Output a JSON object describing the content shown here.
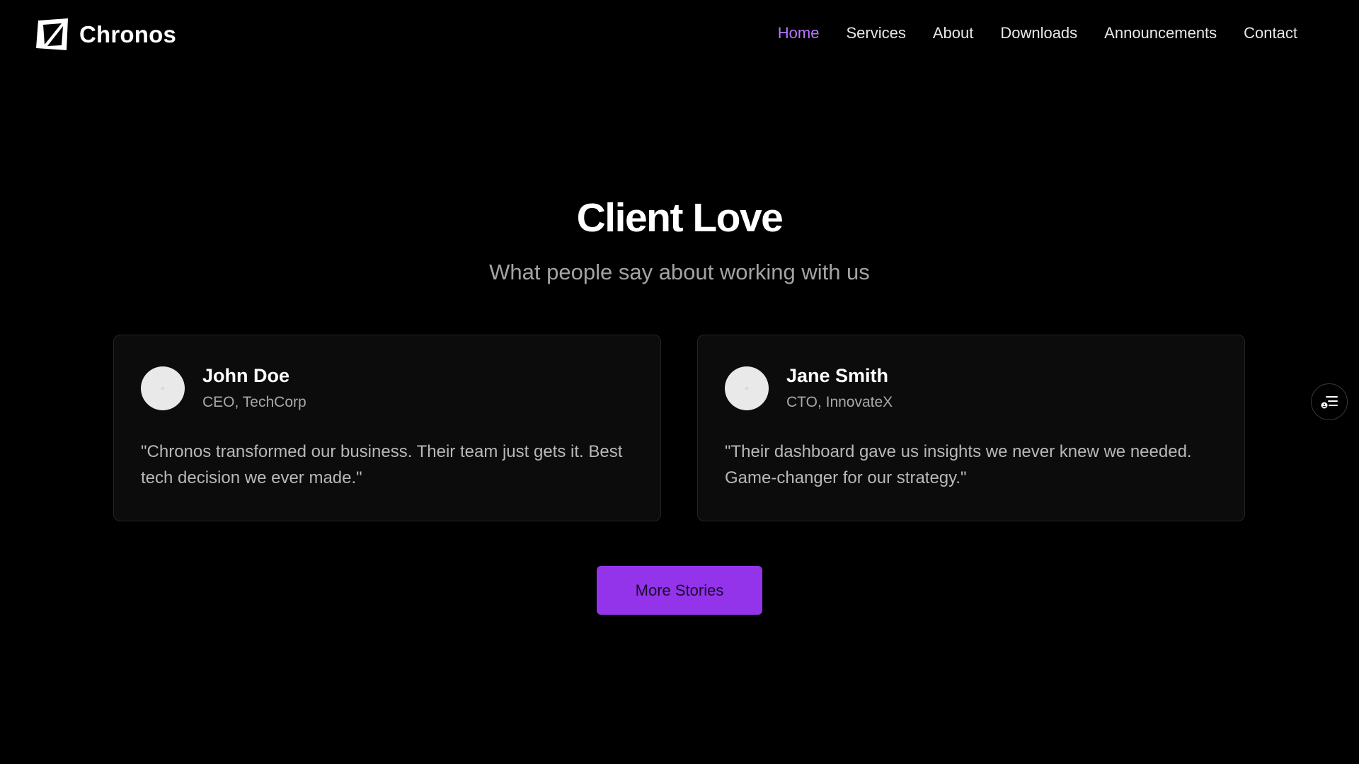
{
  "brand": {
    "name": "Chronos",
    "logo_icon": "chronos-logo-icon"
  },
  "nav": {
    "items": [
      {
        "label": "Home",
        "active": true
      },
      {
        "label": "Services",
        "active": false
      },
      {
        "label": "About",
        "active": false
      },
      {
        "label": "Downloads",
        "active": false
      },
      {
        "label": "Announcements",
        "active": false
      },
      {
        "label": "Contact",
        "active": false
      }
    ]
  },
  "testimonials": {
    "title": "Client Love",
    "subtitle": "What people say about working with us",
    "cards": [
      {
        "name": "John Doe",
        "role": "CEO, TechCorp",
        "quote": "\"Chronos transformed our business. Their team just gets it. Best tech decision we ever made.\""
      },
      {
        "name": "Jane Smith",
        "role": "CTO, InnovateX",
        "quote": "\"Their dashboard gave us insights we never knew we needed. Game-changer for our strategy.\""
      }
    ],
    "cta_label": "More Stories"
  },
  "floating_button": {
    "icon": "accessibility-menu-icon"
  },
  "colors": {
    "background": "#000000",
    "accent": "#9333ea",
    "nav_active": "#b776ff",
    "card_background": "#0c0c0c",
    "muted_text": "#a3a3a3"
  }
}
